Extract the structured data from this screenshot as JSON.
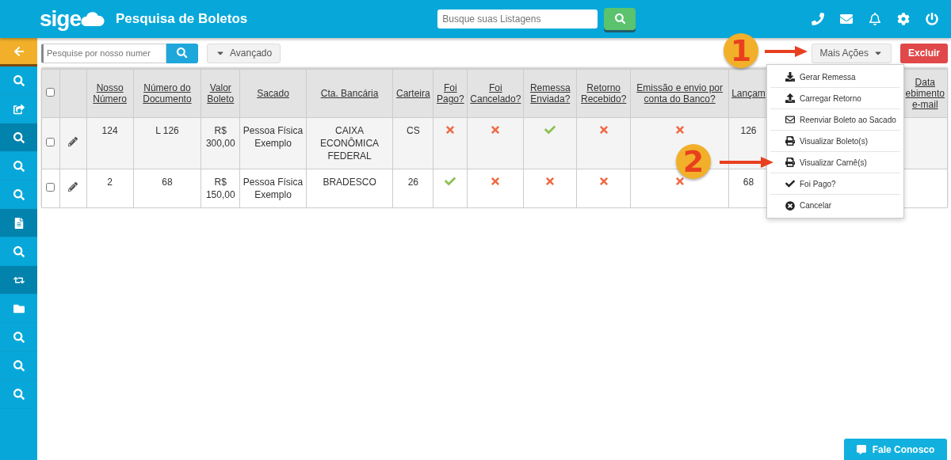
{
  "header": {
    "logo": "sige",
    "title": "Pesquisa de Boletos",
    "search": {
      "placeholder": "Busque suas Listagens"
    }
  },
  "sidebar": {
    "items": [
      {
        "kind": "back",
        "shaded": false
      },
      {
        "kind": "search",
        "shaded": false
      },
      {
        "kind": "share",
        "shaded": false
      },
      {
        "kind": "search",
        "shaded": true
      },
      {
        "kind": "search",
        "shaded": false
      },
      {
        "kind": "search",
        "shaded": false
      },
      {
        "kind": "document",
        "shaded": true
      },
      {
        "kind": "search",
        "shaded": false
      },
      {
        "kind": "swap",
        "shaded": true
      },
      {
        "kind": "folder",
        "shaded": false
      },
      {
        "kind": "search",
        "shaded": false
      },
      {
        "kind": "search",
        "shaded": false
      },
      {
        "kind": "search",
        "shaded": false
      }
    ]
  },
  "toolbar": {
    "search": {
      "placeholder": "Pesquise por nosso numer"
    },
    "advanced": "Avançado",
    "more_actions": "Mais Ações",
    "delete": "Excluir"
  },
  "table": {
    "all_selected": false,
    "columns": [
      "Nosso Número",
      "Número do Documento",
      "Valor Boleto",
      "Sacado",
      "Cta. Bancária",
      "Carteira",
      "Foi Pago?",
      "Foi Cancelado?",
      "Remessa Enviada?",
      "Retorno Recebido?",
      "Emissão e envio por conta do Banco?",
      "Lançam",
      "Data\nebimento\ne-mail"
    ],
    "rows": [
      {
        "checked": false,
        "nosso_numero": "124",
        "numero_documento": "L 126",
        "valor": "R$ 300,00",
        "sacado": "Pessoa Física Exemplo",
        "cta_bancaria": "CAIXA ECONÔMICA FEDERAL",
        "carteira": "CS",
        "foi_pago": false,
        "foi_cancelado": false,
        "remessa_enviada": true,
        "retorno_recebido": false,
        "emissao_banco": false,
        "lancamento": "126"
      },
      {
        "checked": false,
        "nosso_numero": "2",
        "numero_documento": "68",
        "valor": "R$ 150,00",
        "sacado": "Pessoa Física Exemplo",
        "cta_bancaria": "BRADESCO",
        "carteira": "26",
        "foi_pago": true,
        "foi_cancelado": false,
        "remessa_enviada": false,
        "retorno_recebido": false,
        "emissao_banco": false,
        "lancamento": "68"
      }
    ]
  },
  "menu": {
    "items": [
      {
        "kind": "download",
        "label": "Gerar Remessa"
      },
      {
        "kind": "upload",
        "label": "Carregar Retorno"
      },
      {
        "kind": "mail",
        "label": "Reenviar Boleto ao Sacado"
      },
      {
        "kind": "print",
        "label": "Visualizar Boleto(s)"
      },
      {
        "kind": "print",
        "label": "Visualizar Carnê(s)"
      },
      {
        "kind": "check",
        "label": "Foi Pago?"
      },
      {
        "kind": "cancel",
        "label": "Cancelar"
      }
    ]
  },
  "annotations": [
    {
      "label": "1"
    },
    {
      "label": "2"
    }
  ],
  "contact_button": "Fale Conosco"
}
